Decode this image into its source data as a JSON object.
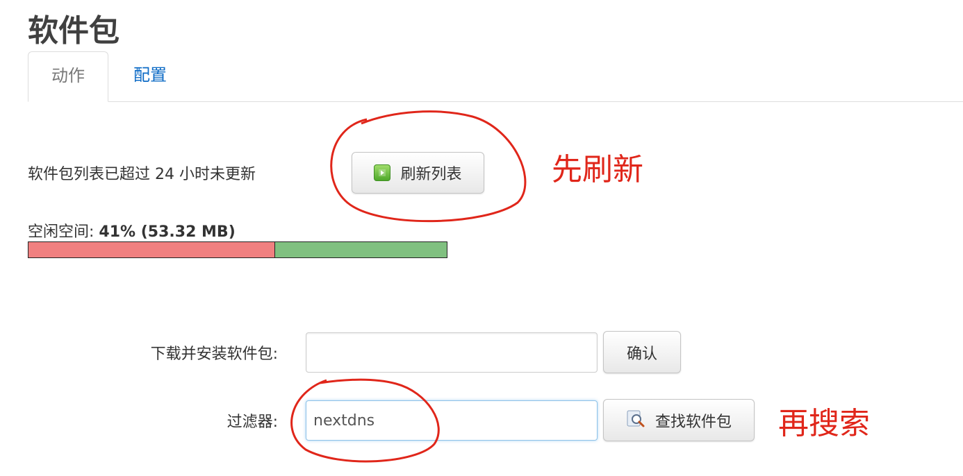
{
  "page": {
    "title": "软件包"
  },
  "tabs": [
    {
      "label": "动作",
      "active": true
    },
    {
      "label": "配置",
      "active": false
    }
  ],
  "status": {
    "update_notice": "软件包列表已超过 24 小时未更新",
    "refresh_button": "刷新列表"
  },
  "storage": {
    "label": "空闲空间:",
    "value": "41% (53.32 MB)",
    "free_percent": 41,
    "used_color": "#f08080",
    "free_color": "#80c080"
  },
  "install": {
    "label": "下载并安装软件包:",
    "value": "",
    "confirm_button": "确认"
  },
  "filter": {
    "label": "过滤器:",
    "value": "nextdns",
    "search_button": "查找软件包"
  },
  "annotations": {
    "step1": "先刷新",
    "step2": "再搜索",
    "color": "#e0261a"
  }
}
